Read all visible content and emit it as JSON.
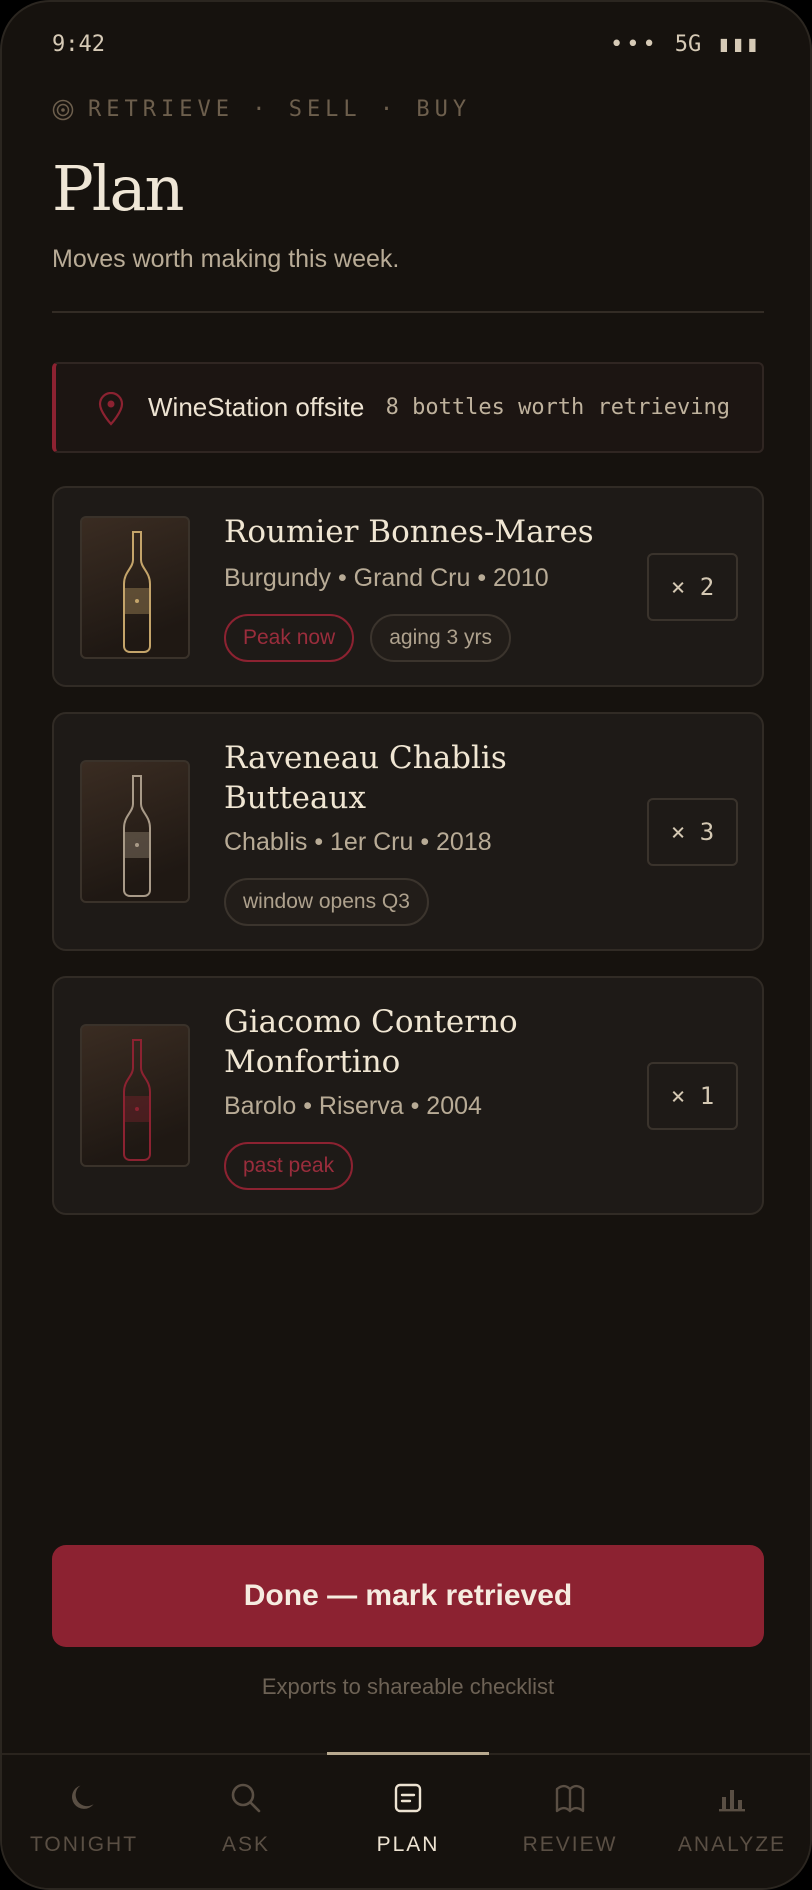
{
  "status": {
    "time": "9:42",
    "dots": "•••",
    "network": "5G",
    "battery": "▮▮▮"
  },
  "header": {
    "eyebrow": "RETRIEVE · SELL · BUY",
    "title": "Plan",
    "subtitle": "Moves worth making this week."
  },
  "location": {
    "icon": "pin-icon",
    "name": "WineStation offsite",
    "count": "8 bottles worth retrieving"
  },
  "wines": [
    {
      "name": "Roumier Bonnes-Mares",
      "meta": "Burgundy • Grand Cru • 2010",
      "tags": [
        {
          "label": "Peak now",
          "style": "red"
        },
        {
          "label": "aging 3 yrs",
          "style": "gray"
        }
      ],
      "qty": "× 2",
      "bottle_color": "#c4a46a"
    },
    {
      "name": "Raveneau Chablis Butteaux",
      "meta": "Chablis • 1er Cru • 2018",
      "tags": [
        {
          "label": "window opens Q3",
          "style": "gray"
        }
      ],
      "qty": "× 3",
      "bottle_color": "#a89a88"
    },
    {
      "name": "Giacomo Conterno Monfortino",
      "meta": "Barolo • Riserva • 2004",
      "tags": [
        {
          "label": "past peak",
          "style": "red"
        }
      ],
      "qty": "× 1",
      "bottle_color": "#8c2231"
    }
  ],
  "cta": {
    "label": "Done — mark retrieved",
    "note": "Exports to shareable checklist"
  },
  "tabs": [
    {
      "label": "TONIGHT",
      "icon": "moon-icon",
      "active": false
    },
    {
      "label": "ASK",
      "icon": "search-icon",
      "active": false
    },
    {
      "label": "PLAN",
      "icon": "plan-icon",
      "active": true
    },
    {
      "label": "REVIEW",
      "icon": "book-icon",
      "active": false
    },
    {
      "label": "ANALYZE",
      "icon": "bar-chart-icon",
      "active": false
    }
  ],
  "colors": {
    "accent": "#8c2231",
    "background": "#16120e",
    "card": "#1e1a17",
    "text": "#efe6d6"
  }
}
